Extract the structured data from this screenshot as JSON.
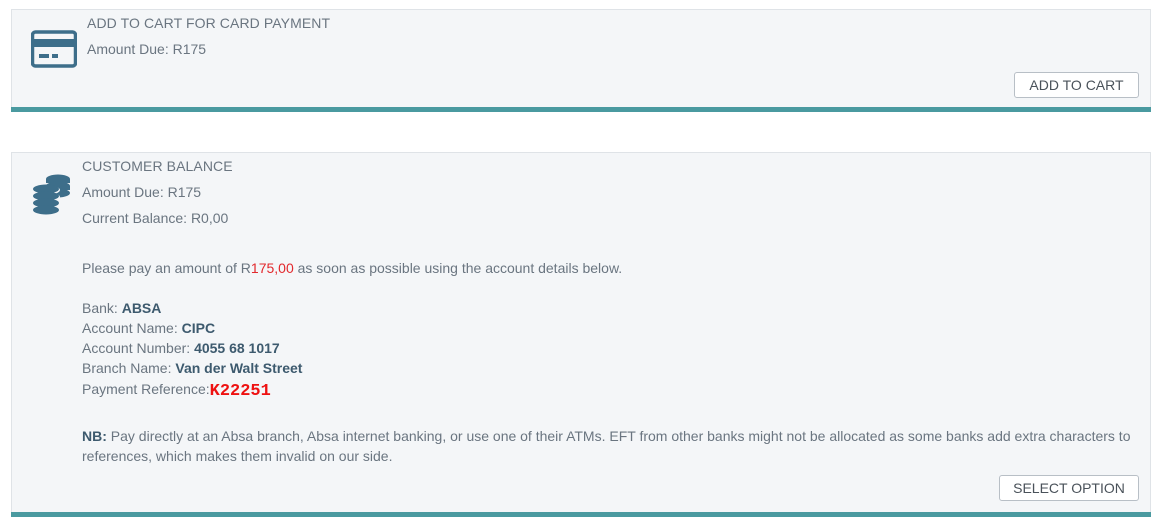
{
  "card_payment": {
    "title": "ADD TO CART FOR CARD PAYMENT",
    "amount_due": "Amount Due: R175",
    "button_label": "ADD TO CART",
    "icon": "credit-card-icon"
  },
  "customer_balance": {
    "title": "CUSTOMER BALANCE",
    "amount_due": "Amount Due: R175",
    "current_balance": "Current Balance: R0,00",
    "icon": "coins-stack-icon",
    "instruction_prefix": "Please pay an amount of ",
    "instruction_amount_r": "R",
    "instruction_amount": "175,00",
    "instruction_suffix": " as soon as possible using the account details below.",
    "bank_label": "Bank: ",
    "bank_value": "ABSA",
    "account_name_label": "Account Name: ",
    "account_name_value": "CIPC",
    "account_number_label": "Account Number: ",
    "account_number_value": "4055 68 1017",
    "branch_name_label": "Branch Name: ",
    "branch_name_value": "Van der Walt Street",
    "payment_reference_label": "Payment Reference:",
    "payment_reference_value": "K22251",
    "nb_label": "NB:",
    "nb_text": " Pay directly at an Absa branch, Absa internet banking, or use one of their ATMs. EFT from other banks might not be allocated as some banks add extra characters to references, which makes them invalid on our side.",
    "button_label": "SELECT OPTION"
  },
  "colors": {
    "accent_bar": "#4a9aa0",
    "icon": "#3d6e8a",
    "highlight_red": "#e2292d",
    "card_background": "#f4f6f8"
  }
}
